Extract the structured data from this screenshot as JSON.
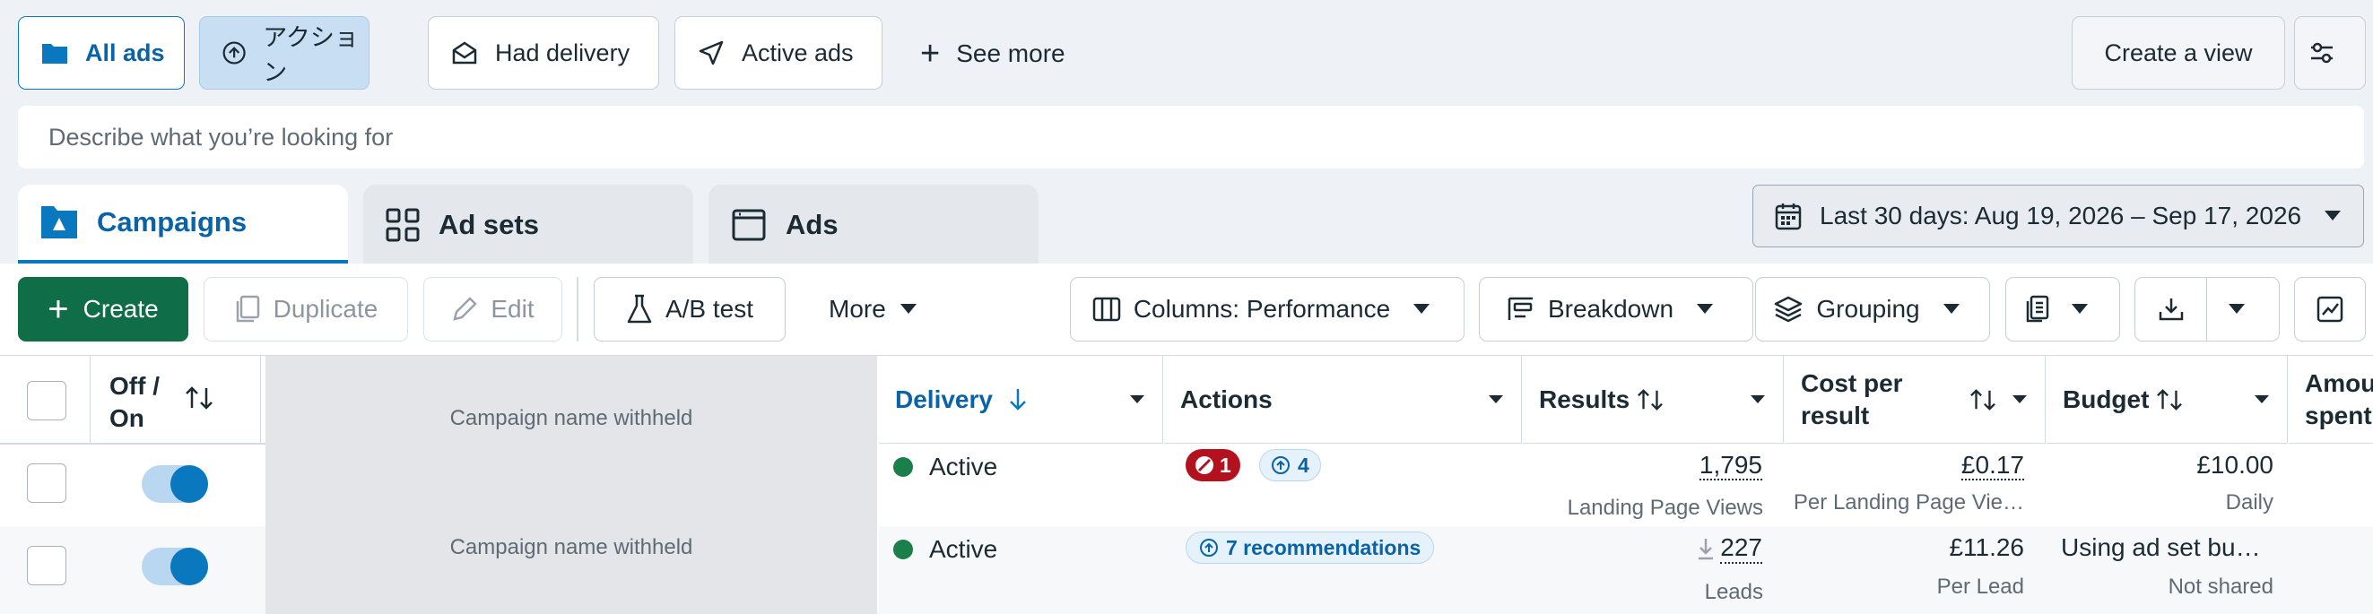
{
  "filters": [
    {
      "label": "All ads",
      "icon": "folder-icon",
      "active": true
    },
    {
      "label": "アクション",
      "icon": "arrow-up-circle-icon"
    },
    {
      "label": "Had delivery",
      "icon": "envelope-open-icon"
    },
    {
      "label": "Active ads",
      "icon": "send-icon"
    }
  ],
  "see_more": "See more",
  "create_view": "Create a view",
  "search": {
    "placeholder": "Describe what you’re looking for"
  },
  "tabs": {
    "campaigns": "Campaigns",
    "adsets": "Ad sets",
    "ads": "Ads"
  },
  "date_range": "Last 30 days: Aug 19, 2026 – Sep 17, 2026",
  "toolbar": {
    "create": "Create",
    "duplicate": "Duplicate",
    "edit": "Edit",
    "ab_test": "A/B test",
    "more": "More",
    "columns": "Columns: Performance",
    "breakdown": "Breakdown",
    "grouping": "Grouping"
  },
  "columns": {
    "off_on_1": "Off /",
    "off_on_2": "On",
    "delivery": "Delivery",
    "actions": "Actions",
    "results": "Results",
    "cost_1": "Cost per",
    "cost_2": "result",
    "budget": "Budget",
    "amount_1": "Amou",
    "amount_2": "spent"
  },
  "rows": [
    {
      "name": "Campaign name withheld",
      "delivery": "Active",
      "issues": "1",
      "recs": "4",
      "results": "1,795",
      "results_sub": "Landing Page Views",
      "cost": "£0.17",
      "cost_sub": "Per Landing Page Vie…",
      "budget": "£10.00",
      "budget_sub": "Daily",
      "on": true
    },
    {
      "name": "Campaign name withheld",
      "delivery": "Active",
      "recs_text": "7 recommendations",
      "results": "227",
      "results_sub": "Leads",
      "cost": "£11.26",
      "cost_sub": "Per Lead",
      "budget": "Using ad set bu…",
      "budget_sub": "Not shared",
      "on": true
    }
  ],
  "colors": {
    "primary": "#0a78be",
    "create_green": "#0f6e47",
    "danger": "#b3111e",
    "active_green": "#1a7f4b"
  }
}
